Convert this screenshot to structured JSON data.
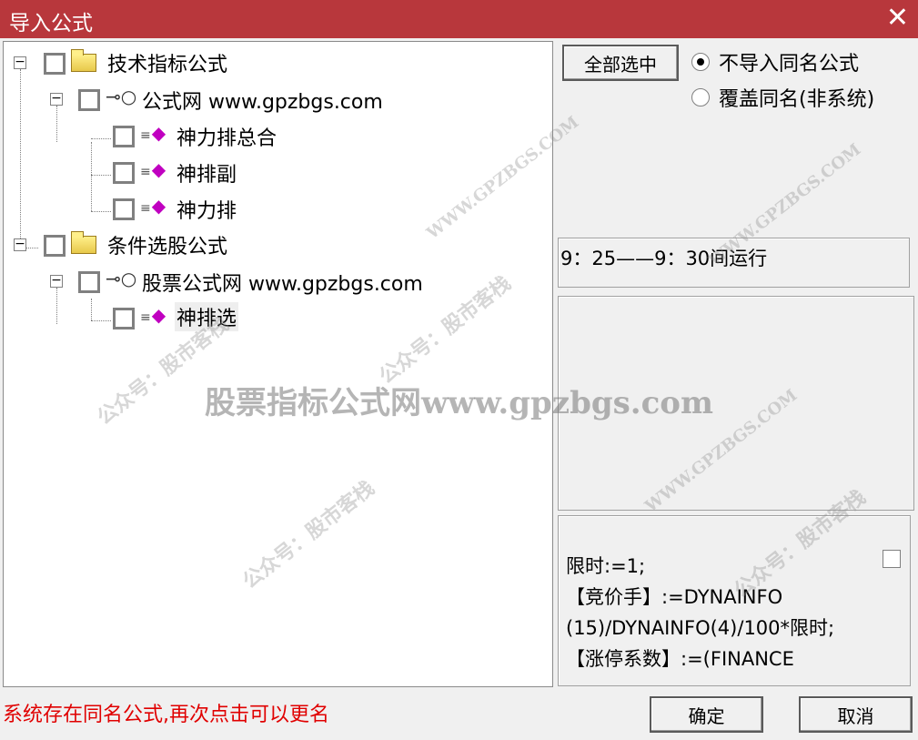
{
  "window": {
    "title": "导入公式",
    "close_glyph": "✕"
  },
  "tree": {
    "groups": [
      {
        "label": "技术指标公式",
        "source": {
          "label": "公式网 www.gpzbgs.com",
          "items": [
            "神力排总合",
            "神排副",
            "神力排"
          ]
        }
      },
      {
        "label": "条件选股公式",
        "source": {
          "label": "股票公式网 www.gpzbgs.com",
          "items": [
            "神排选"
          ]
        }
      }
    ],
    "expander_glyph": "−"
  },
  "options": {
    "select_all_label": "全部选中",
    "radio_options": [
      {
        "label": "不导入同名公式",
        "checked": true
      },
      {
        "label": "覆盖同名(非系统)",
        "checked": false
      }
    ]
  },
  "description": "9：25——9：30间运行",
  "code_lines": [
    "限时:=1;",
    "【竞价手】:=DYNAINFO",
    "(15)/DYNAINFO(4)/100*限时;",
    "【涨停系数】:=(FINANCE"
  ],
  "status_message": "系统存在同名公式,再次点击可以更名",
  "buttons": {
    "ok_label": "确定",
    "cancel_label": "取消"
  },
  "watermarks": {
    "main": "股票指标公式网www.gpzbgs.com",
    "site": "WWW.GPZBGS.COM",
    "account": "公众号：股市客栈"
  },
  "icons": {
    "folder": "folder-icon",
    "source": "key-icon",
    "formula": "formula-gem-icon",
    "close": "close-icon"
  },
  "colors": {
    "titlebar": "#b8373c",
    "status_text": "#e00000",
    "formula_icon": "#c000c0"
  }
}
